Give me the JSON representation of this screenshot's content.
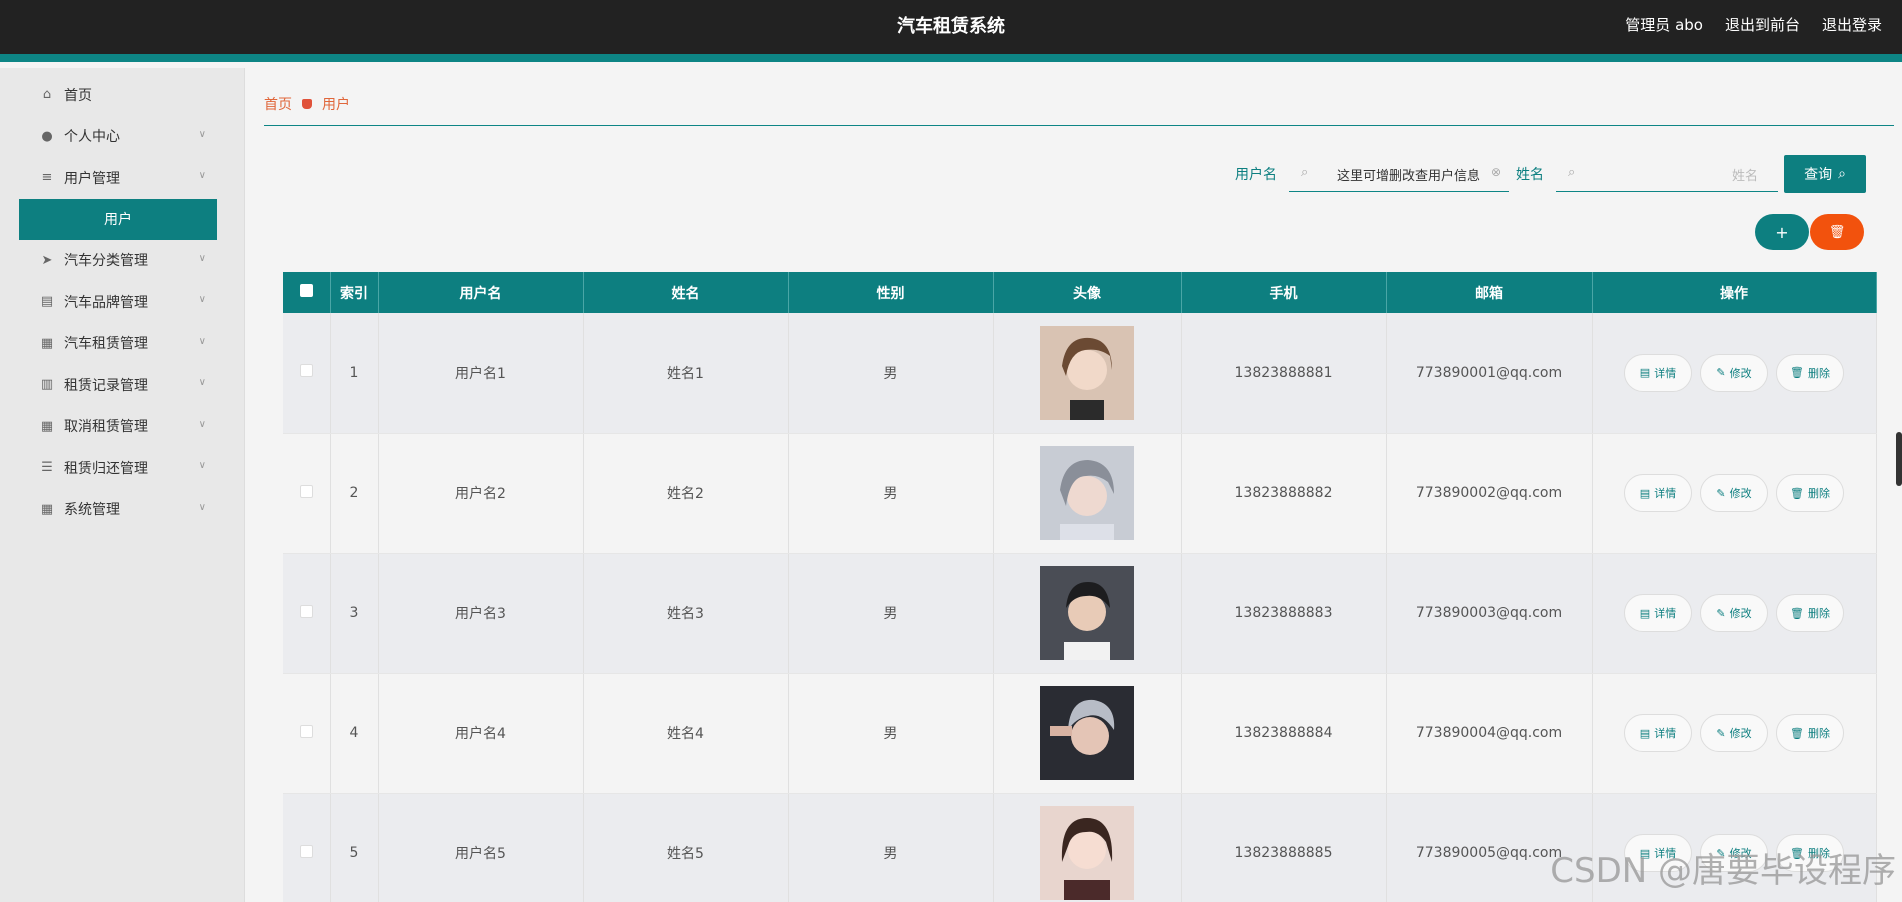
{
  "app": {
    "title": "汽车租赁系统",
    "admin": "管理员 abo",
    "front_link": "退出到前台",
    "logout": "退出登录"
  },
  "sidebar": {
    "items": [
      {
        "label": "首页",
        "icon": "home-icon"
      },
      {
        "label": "个人中心",
        "icon": "person-icon"
      },
      {
        "label": "用户管理",
        "icon": "list-icon"
      },
      {
        "label": "汽车分类管理",
        "icon": "send-icon"
      },
      {
        "label": "汽车品牌管理",
        "icon": "clipboard-icon"
      },
      {
        "label": "汽车租赁管理",
        "icon": "grid-icon"
      },
      {
        "label": "租赁记录管理",
        "icon": "book-icon"
      },
      {
        "label": "取消租赁管理",
        "icon": "grid-icon"
      },
      {
        "label": "租赁归还管理",
        "icon": "sliders-icon"
      },
      {
        "label": "系统管理",
        "icon": "grid-icon"
      }
    ],
    "active_sub": "用户"
  },
  "breadcrumb": {
    "home": "首页",
    "current": "用户"
  },
  "search": {
    "username_label": "用户名",
    "username_value": "这里可增删改查用户信息",
    "name_label": "姓名",
    "name_placeholder": "姓名",
    "query_label": "查询"
  },
  "actions": {
    "add": "+",
    "delete": "🗑"
  },
  "table": {
    "columns": [
      "索引",
      "用户名",
      "姓名",
      "性别",
      "头像",
      "手机",
      "邮箱",
      "操作"
    ],
    "rows": [
      {
        "index": "1",
        "username": "用户名1",
        "name": "姓名1",
        "gender": "男",
        "phone": "13823888881",
        "email": "773890001@qq.com"
      },
      {
        "index": "2",
        "username": "用户名2",
        "name": "姓名2",
        "gender": "男",
        "phone": "13823888882",
        "email": "773890002@qq.com"
      },
      {
        "index": "3",
        "username": "用户名3",
        "name": "姓名3",
        "gender": "男",
        "phone": "13823888883",
        "email": "773890003@qq.com"
      },
      {
        "index": "4",
        "username": "用户名4",
        "name": "姓名4",
        "gender": "男",
        "phone": "13823888884",
        "email": "773890004@qq.com"
      },
      {
        "index": "5",
        "username": "用户名5",
        "name": "姓名5",
        "gender": "男",
        "phone": "13823888885",
        "email": "773890005@qq.com"
      }
    ],
    "ops": {
      "detail": "详情",
      "edit": "修改",
      "delete": "删除"
    }
  },
  "watermark": "CSDN @唐要毕设程序",
  "colors": {
    "primary": "#0d7f80",
    "danger": "#f2520d",
    "topbar": "#222222"
  }
}
